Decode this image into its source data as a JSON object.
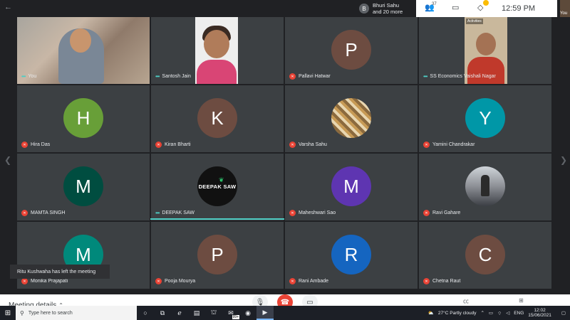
{
  "window": {
    "back_icon": "arrow-left-icon"
  },
  "topbar": {
    "presenter_initial": "B",
    "presenter_line1": "Bhuri Sahu",
    "presenter_line2": "and 20 more",
    "participants_count": "37",
    "time": "12:59 PM",
    "self_label": "You"
  },
  "tiles": [
    {
      "id": "you",
      "name": "You",
      "kind": "video",
      "state": "dots"
    },
    {
      "id": "santosh",
      "name": "Santosh Jain",
      "kind": "video",
      "state": "dots"
    },
    {
      "id": "pallavi",
      "name": "Pallavi Hatwar",
      "kind": "avatar",
      "initial": "P",
      "color": "#6d4c41",
      "state": "muted"
    },
    {
      "id": "ss",
      "name": "SS Economics Vaishali Nagar",
      "kind": "video",
      "state": "dots",
      "badge": "Activities"
    },
    {
      "id": "hira",
      "name": "Hira Das",
      "kind": "avatar",
      "initial": "H",
      "color": "#689f38",
      "state": "muted"
    },
    {
      "id": "kiran",
      "name": "Kiran Bharti",
      "kind": "avatar",
      "initial": "K",
      "color": "#6d4c41",
      "state": "muted"
    },
    {
      "id": "varsha",
      "name": "Varsha Sahu",
      "kind": "image",
      "state": "muted"
    },
    {
      "id": "yamini",
      "name": "Yamini Chandrakar",
      "kind": "avatar",
      "initial": "Y",
      "color": "#0097a7",
      "state": "muted"
    },
    {
      "id": "mamta",
      "name": "MAMTA SINGH",
      "kind": "avatar",
      "initial": "M",
      "color": "#004d40",
      "state": "muted"
    },
    {
      "id": "deepak",
      "name": "DEEPAK SAW",
      "kind": "image",
      "state": "dots",
      "logo_text": "DEEPAK SAW"
    },
    {
      "id": "maheshwari",
      "name": "Maheshwari Sao",
      "kind": "avatar",
      "initial": "M",
      "color": "#5e35b1",
      "state": "muted"
    },
    {
      "id": "ravi",
      "name": "Ravi Gahare",
      "kind": "image",
      "state": "muted"
    },
    {
      "id": "monika",
      "name": "Monika Prajapati",
      "kind": "avatar",
      "initial": "M",
      "color": "#00897b",
      "state": "muted"
    },
    {
      "id": "pooja",
      "name": "Pooja Mourya",
      "kind": "avatar",
      "initial": "P",
      "color": "#6d4c41",
      "state": "muted"
    },
    {
      "id": "rani",
      "name": "Rani Ambade",
      "kind": "avatar",
      "initial": "R",
      "color": "#1565c0",
      "state": "muted"
    },
    {
      "id": "chetna",
      "name": "Chetna Raut",
      "kind": "avatar",
      "initial": "C",
      "color": "#6d4c41",
      "state": "muted"
    }
  ],
  "toast": "Ritu Kushwaha has left the meeting",
  "bottombar": {
    "meeting_details": "Meeting details"
  },
  "taskbar": {
    "search_placeholder": "Type here to search",
    "weather": "27°C  Partly cloudy",
    "lang": "ENG",
    "clock_time": "12:02",
    "clock_date": "15/06/2021",
    "badge": "99+"
  },
  "colors": {
    "accent": "#4ecdc4",
    "muted": "#ea4335",
    "tile_bg": "#3c4043"
  }
}
